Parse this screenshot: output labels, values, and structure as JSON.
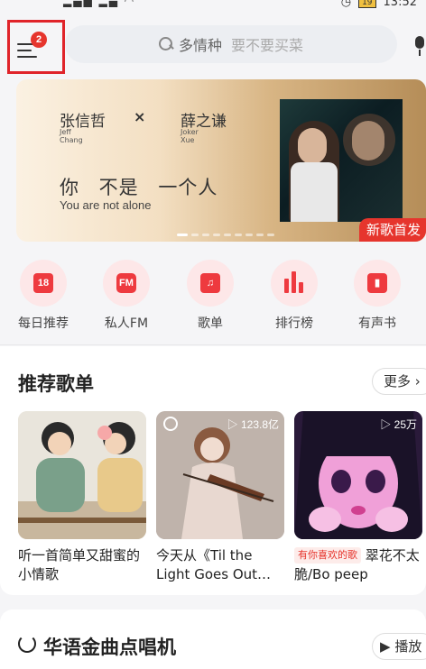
{
  "status_bar": {
    "time": "13:52",
    "battery": "19"
  },
  "header": {
    "menu_badge": "2",
    "search_placeholder_main": "多情种",
    "search_placeholder_sub": "要不要买菜"
  },
  "banner": {
    "artist1": "张信哲",
    "artist1_en": "Jeff\nChang",
    "x_mark": "×",
    "artist2": "薛之谦",
    "artist2_en": "Joker\nXue",
    "song_title": "你 不是 一个人",
    "song_title_en": "You are not alone",
    "tag": "新歌首发"
  },
  "quick_access": [
    {
      "label": "每日推荐",
      "icon": "calendar-18-icon",
      "glyph": "18"
    },
    {
      "label": "私人FM",
      "icon": "radio-icon",
      "glyph": "FM"
    },
    {
      "label": "歌单",
      "icon": "playlist-icon",
      "glyph": "♫"
    },
    {
      "label": "排行榜",
      "icon": "chart-bars-icon",
      "glyph": ""
    },
    {
      "label": "有声书",
      "icon": "audiobook-icon",
      "glyph": "▮"
    }
  ],
  "recommended": {
    "title": "推荐歌单",
    "more": "更多",
    "cards": [
      {
        "caption": "听一首简单又甜蜜的小情歌",
        "play_count": ""
      },
      {
        "caption": "今天从《Til the Light Goes Out…",
        "play_count": "123.8亿"
      },
      {
        "pill": "有你喜欢的歌",
        "caption": "翠花不太脆/Bo peep",
        "play_count": "25万"
      }
    ]
  },
  "section2": {
    "title": "华语金曲点唱机",
    "play": "播放"
  },
  "colors": {
    "accent": "#e6352d",
    "highlight_box": "#e0242a"
  }
}
